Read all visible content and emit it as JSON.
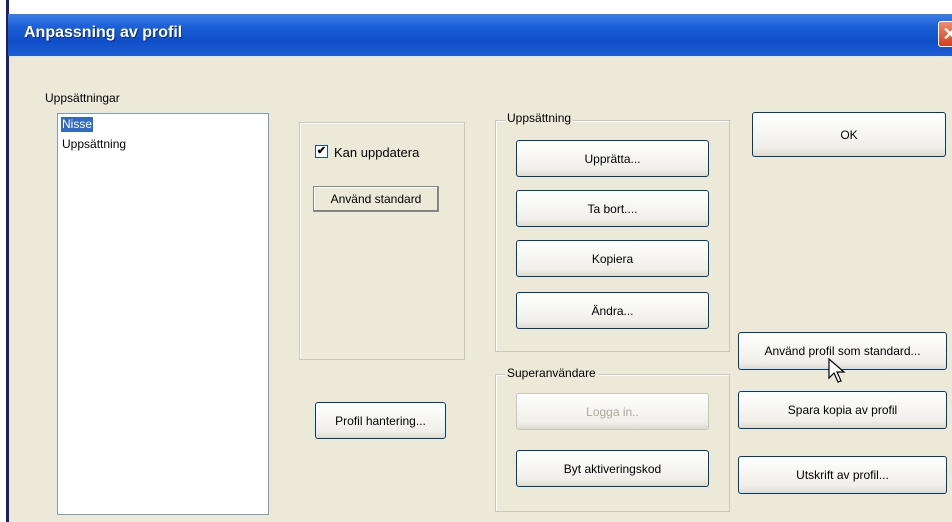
{
  "window": {
    "title": "Anpassning av profil",
    "close_glyph": "✕"
  },
  "setups": {
    "label": "Uppsättningar",
    "items": [
      {
        "label": "Nisse",
        "selected": true
      },
      {
        "label": "Uppsättning",
        "selected": false
      }
    ]
  },
  "middle": {
    "checkbox": {
      "label": "Kan uppdatera",
      "checked": true,
      "mark": "✔"
    },
    "use_standard": "Använd standard",
    "profile_management": "Profil hantering..."
  },
  "setup_group": {
    "legend": "Uppsättning",
    "buttons": [
      "Upprätta...",
      "Ta bort....",
      "Kopiera",
      "Ändra..."
    ]
  },
  "superuser_group": {
    "legend": "Superanvändare",
    "login": "Logga in..",
    "change_code": "Byt aktiveringskod"
  },
  "right": {
    "ok": "OK",
    "use_profile_standard": "Använd profil som standard...",
    "save_copy": "Spara kopia av profil",
    "print_profile": "Utskrift av profil..."
  }
}
